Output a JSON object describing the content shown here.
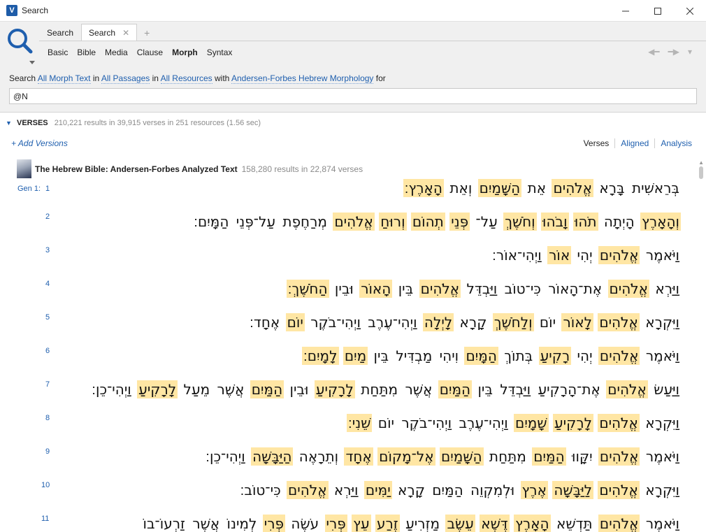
{
  "window": {
    "title": "Search"
  },
  "tabs": [
    {
      "label": "Search",
      "active": false
    },
    {
      "label": "Search",
      "active": true
    }
  ],
  "modes": [
    {
      "label": "Basic",
      "active": false
    },
    {
      "label": "Bible",
      "active": false
    },
    {
      "label": "Media",
      "active": false
    },
    {
      "label": "Clause",
      "active": false
    },
    {
      "label": "Morph",
      "active": true
    },
    {
      "label": "Syntax",
      "active": false
    }
  ],
  "query": {
    "p1": "Search",
    "scope_text": "All Morph Text",
    "p2": "in",
    "passages": "All Passages",
    "p3": "in",
    "resources": "All Resources",
    "p4": "with",
    "morphology": "Andersen-Forbes Hebrew Morphology",
    "p5": "for",
    "input_value": "@N"
  },
  "results": {
    "verses_label": "VERSES",
    "summary": "210,221 results in 39,915 verses in 251 resources (1.56 sec)",
    "add_versions": "+ Add Versions",
    "views": [
      "Verses",
      "Aligned",
      "Analysis"
    ],
    "resource_name": "The Hebrew Bible: Andersen-Forbes Analyzed Text",
    "resource_meta": "158,280 results in 22,874 verses"
  },
  "verses": [
    {
      "ref": "Gen 1:",
      "num": "1",
      "words": [
        {
          "t": "בְּרֵאשִׁית",
          "h": false
        },
        {
          "t": "בָּרָא",
          "h": false
        },
        {
          "t": "אֱלֹהִים",
          "h": true
        },
        {
          "t": "אֵת",
          "h": false
        },
        {
          "t": "הַשָּׁמַיִם",
          "h": true
        },
        {
          "t": "וְאֵת",
          "h": false
        },
        {
          "t": "הָאָרֶץ׃",
          "h": true
        }
      ]
    },
    {
      "ref": "",
      "num": "2",
      "words": [
        {
          "t": "וְהָאָרֶץ",
          "h": true
        },
        {
          "t": "הָיְתָה",
          "h": false
        },
        {
          "t": "תֹהוּ",
          "h": true
        },
        {
          "t": "וָבֹהוּ",
          "h": true
        },
        {
          "t": "וְחֹשֶׁךְ",
          "h": true
        },
        {
          "t": "עַל־",
          "h": false
        },
        {
          "t": "פְּנֵי",
          "h": true
        },
        {
          "t": "תְהוֹם",
          "h": true
        },
        {
          "t": "וְרוּחַ",
          "h": true
        },
        {
          "t": "אֱלֹהִים",
          "h": true
        },
        {
          "t": "מְרַחֶפֶת",
          "h": false
        },
        {
          "t": "עַל־פְּנֵי",
          "h": false
        },
        {
          "t": "הַמָּיִם׃",
          "h": false
        }
      ]
    },
    {
      "ref": "",
      "num": "3",
      "words": [
        {
          "t": "וַיֹּאמֶר",
          "h": false
        },
        {
          "t": "אֱלֹהִים",
          "h": true
        },
        {
          "t": "יְהִי",
          "h": false
        },
        {
          "t": "אוֹר",
          "h": true
        },
        {
          "t": "וַיְהִי־אוֹר׃",
          "h": false
        }
      ]
    },
    {
      "ref": "",
      "num": "4",
      "words": [
        {
          "t": "וַיַּרְא",
          "h": false
        },
        {
          "t": "אֱלֹהִים",
          "h": true
        },
        {
          "t": "אֶת־הָאוֹר",
          "h": false
        },
        {
          "t": "כִּי־טוֹב",
          "h": false
        },
        {
          "t": "וַיַּבְדֵּל",
          "h": false
        },
        {
          "t": "אֱלֹהִים",
          "h": true
        },
        {
          "t": "בֵּין",
          "h": false
        },
        {
          "t": "הָאוֹר",
          "h": true
        },
        {
          "t": "וּבֵין",
          "h": false
        },
        {
          "t": "הַחֹשֶׁךְ׃",
          "h": true
        }
      ]
    },
    {
      "ref": "",
      "num": "5",
      "words": [
        {
          "t": "וַיִּקְרָא",
          "h": false
        },
        {
          "t": "אֱלֹהִים",
          "h": true
        },
        {
          "t": "לָאוֹר",
          "h": true
        },
        {
          "t": "יוֹם",
          "h": false
        },
        {
          "t": "וְלַחֹשֶׁךְ",
          "h": true
        },
        {
          "t": "קָרָא",
          "h": false
        },
        {
          "t": "לָיְלָה",
          "h": true
        },
        {
          "t": "וַיְהִי־עֶרֶב",
          "h": false
        },
        {
          "t": "וַיְהִי־בֹקֶר",
          "h": false
        },
        {
          "t": "יוֹם",
          "h": true
        },
        {
          "t": "אֶחָד׃",
          "h": false
        }
      ]
    },
    {
      "ref": "",
      "num": "6",
      "words": [
        {
          "t": "וַיֹּאמֶר",
          "h": false
        },
        {
          "t": "אֱלֹהִים",
          "h": true
        },
        {
          "t": "יְהִי",
          "h": false
        },
        {
          "t": "רָקִיעַ",
          "h": true
        },
        {
          "t": "בְּתוֹךְ",
          "h": false
        },
        {
          "t": "הַמָּיִם",
          "h": true
        },
        {
          "t": "וִיהִי",
          "h": false
        },
        {
          "t": "מַבְדִּיל",
          "h": false
        },
        {
          "t": "בֵּין",
          "h": false
        },
        {
          "t": "מַיִם",
          "h": true
        },
        {
          "t": "לָמָיִם׃",
          "h": true
        }
      ]
    },
    {
      "ref": "",
      "num": "7",
      "words": [
        {
          "t": "וַיַּעַשׂ",
          "h": false
        },
        {
          "t": "אֱלֹהִים",
          "h": true
        },
        {
          "t": "אֶת־הָרָקִיעַ",
          "h": false
        },
        {
          "t": "וַיַּבְדֵּל",
          "h": false
        },
        {
          "t": "בֵּין",
          "h": false
        },
        {
          "t": "הַמַּיִם",
          "h": true
        },
        {
          "t": "אֲשֶׁר",
          "h": false
        },
        {
          "t": "מִתַּחַת",
          "h": false
        },
        {
          "t": "לָרָקִיעַ",
          "h": true
        },
        {
          "t": "וּבֵין",
          "h": false
        },
        {
          "t": "הַמַּיִם",
          "h": true
        },
        {
          "t": "אֲשֶׁר",
          "h": false
        },
        {
          "t": "מֵעַל",
          "h": false
        },
        {
          "t": "לָרָקִיעַ",
          "h": true
        },
        {
          "t": "וַיְהִי־כֵן׃",
          "h": false
        }
      ]
    },
    {
      "ref": "",
      "num": "8",
      "words": [
        {
          "t": "וַיִּקְרָא",
          "h": false
        },
        {
          "t": "אֱלֹהִים",
          "h": true
        },
        {
          "t": "לָרָקִיעַ",
          "h": true
        },
        {
          "t": "שָׁמָיִם",
          "h": true
        },
        {
          "t": "וַיְהִי־עֶרֶב",
          "h": false
        },
        {
          "t": "וַיְהִי־בֹקֶר",
          "h": false
        },
        {
          "t": "יוֹם",
          "h": false
        },
        {
          "t": "שֵׁנִי׃",
          "h": true
        }
      ]
    },
    {
      "ref": "",
      "num": "9",
      "words": [
        {
          "t": "וַיֹּאמֶר",
          "h": false
        },
        {
          "t": "אֱלֹהִים",
          "h": true
        },
        {
          "t": "יִקָּווּ",
          "h": false
        },
        {
          "t": "הַמַּיִם",
          "h": true
        },
        {
          "t": "מִתַּחַת",
          "h": false
        },
        {
          "t": "הַשָּׁמַיִם",
          "h": true
        },
        {
          "t": "אֶל־מָקוֹם",
          "h": true
        },
        {
          "t": "אֶחָד",
          "h": true
        },
        {
          "t": "וְתֵרָאֶה",
          "h": false
        },
        {
          "t": "הַיַּבָּשָׁה",
          "h": true
        },
        {
          "t": "וַיְהִי־כֵן׃",
          "h": false
        }
      ]
    },
    {
      "ref": "",
      "num": "10",
      "words": [
        {
          "t": "וַיִּקְרָא",
          "h": false
        },
        {
          "t": "אֱלֹהִים",
          "h": true
        },
        {
          "t": "לַיַּבָּשָׁה",
          "h": true
        },
        {
          "t": "אֶרֶץ",
          "h": true
        },
        {
          "t": "וּלְמִקְוֵה",
          "h": false
        },
        {
          "t": "הַמַּיִם",
          "h": false
        },
        {
          "t": "קָרָא",
          "h": false
        },
        {
          "t": "יַמִּים",
          "h": true
        },
        {
          "t": "וַיַּרְא",
          "h": false
        },
        {
          "t": "אֱלֹהִים",
          "h": true
        },
        {
          "t": "כִּי־טוֹב׃",
          "h": false
        }
      ]
    },
    {
      "ref": "",
      "num": "11",
      "words": [
        {
          "t": "וַיֹּאמֶר",
          "h": false
        },
        {
          "t": "אֱלֹהִים",
          "h": true
        },
        {
          "t": "תַּדְשֵׁא",
          "h": false
        },
        {
          "t": "הָאָרֶץ",
          "h": true
        },
        {
          "t": "דֶּשֶׁא",
          "h": true
        },
        {
          "t": "עֵשֶׂב",
          "h": true
        },
        {
          "t": "מַזְרִיעַ",
          "h": false
        },
        {
          "t": "זֶרַע",
          "h": true
        },
        {
          "t": "עֵץ",
          "h": true
        },
        {
          "t": "פְּרִי",
          "h": true
        },
        {
          "t": "עֹשֶׂה",
          "h": false
        },
        {
          "t": "פְּרִי",
          "h": true
        },
        {
          "t": "לְמִינוֹ",
          "h": false
        },
        {
          "t": "אֲשֶׁר",
          "h": false
        },
        {
          "t": "זַרְעוֹ־בוֹ",
          "h": false
        }
      ]
    }
  ]
}
